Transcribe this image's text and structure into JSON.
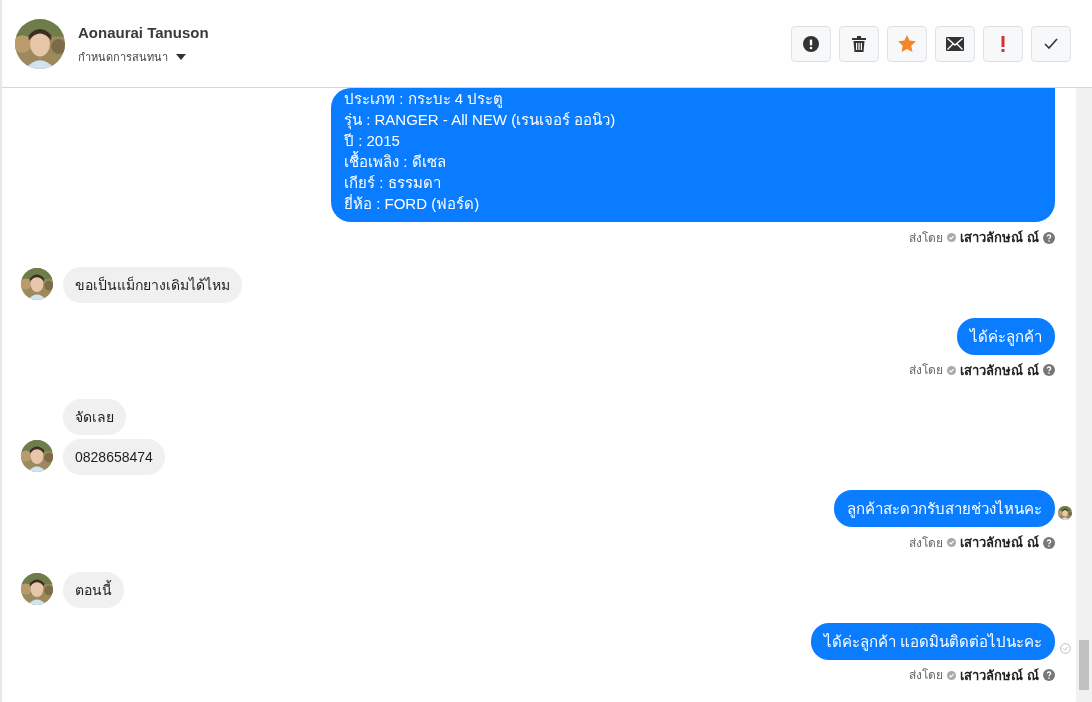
{
  "header": {
    "contact_name": "Aonaurai Tanuson",
    "subtitle": "กำหนดการสนทนา",
    "actions": [
      {
        "kind": "alert"
      },
      {
        "kind": "delete"
      },
      {
        "kind": "star"
      },
      {
        "kind": "mail"
      },
      {
        "kind": "important"
      },
      {
        "kind": "done"
      }
    ]
  },
  "messages": [
    {
      "kind": "outgoing",
      "lines": [
        "ประเภท : กระบะ 4 ประตู",
        "รุ่น : RANGER - All NEW (เรนเจอร์ ออนิว)",
        "ปี : 2015",
        "เชื้อเพลิง : ดีเซล",
        "เกียร์ : ธรรมดา",
        "ยี่ห้อ : FORD (ฟอร์ด)"
      ],
      "seen": false,
      "delivered": false,
      "sent_by": {
        "label": "ส่งโดย",
        "name": "เสาวลักษณ์ ณ์"
      }
    },
    {
      "kind": "incoming",
      "lines": [
        "ขอเป็นแม็กยางเดิมได้ไหม"
      ],
      "avatar": true
    },
    {
      "kind": "outgoing",
      "lines": [
        "ได้ค่ะลูกค้า"
      ],
      "seen": false,
      "delivered": false,
      "sent_by": {
        "label": "ส่งโดย",
        "name": "เสาวลักษณ์ ณ์"
      }
    },
    {
      "kind": "incoming",
      "lines": [
        "จัดเลย"
      ],
      "avatar": false
    },
    {
      "kind": "incoming",
      "lines": [
        "0828658474"
      ],
      "avatar": true
    },
    {
      "kind": "outgoing",
      "lines": [
        "ลูกค้าสะดวกรับสายช่วงไหนคะ"
      ],
      "seen": true,
      "delivered": false,
      "sent_by": {
        "label": "ส่งโดย",
        "name": "เสาวลักษณ์ ณ์"
      }
    },
    {
      "kind": "incoming",
      "lines": [
        "ตอนนี้"
      ],
      "avatar": true
    },
    {
      "kind": "outgoing",
      "lines": [
        "ได้ค่ะลูกค้า แอดมินติดต่อไปนะคะ"
      ],
      "seen": false,
      "delivered": true,
      "sent_by": {
        "label": "ส่งโดย",
        "name": "เสาวลักษณ์ ณ์"
      }
    }
  ]
}
